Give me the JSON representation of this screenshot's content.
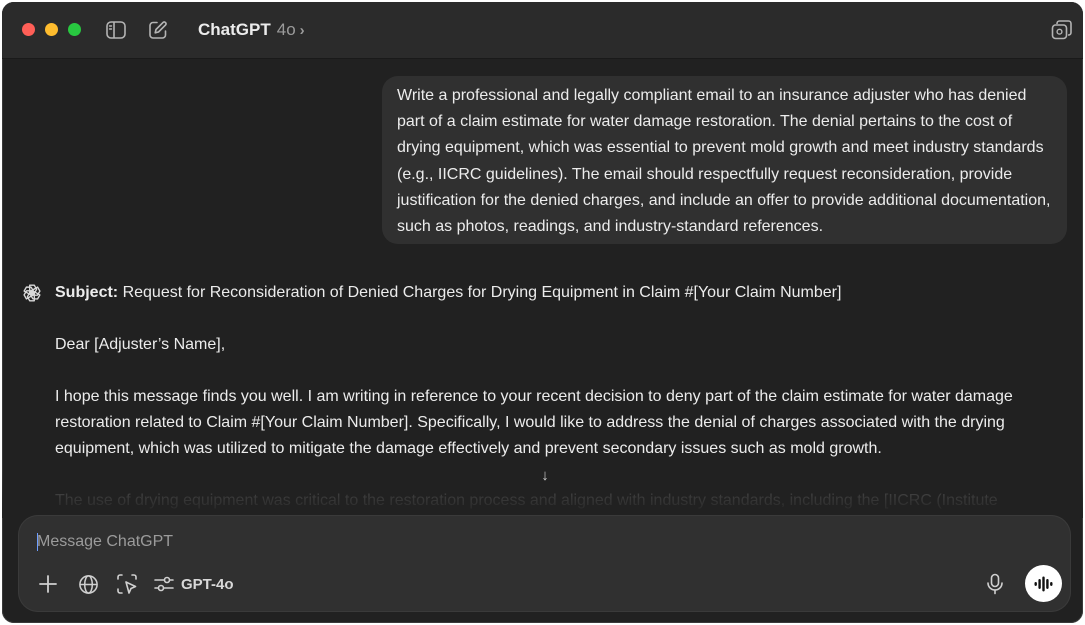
{
  "window": {
    "title": "ChatGPT",
    "model": "4o",
    "title_chevron": "›"
  },
  "user_message": {
    "text": "Write a professional and legally compliant email to an insurance adjuster who has denied part of a claim estimate for water damage restoration. The denial pertains to the cost of drying equipment, which was essential to prevent mold growth and meet industry standards (e.g., IICRC guidelines). The email should respectfully request reconsideration, provide justification for the denied charges, and include an offer to provide additional documentation, such as photos, readings, and industry-standard references."
  },
  "assistant_message": {
    "subject_label": "Subject:",
    "subject_text": " Request for Reconsideration of Denied Charges for Drying Equipment in Claim #[Your Claim Number]",
    "greeting": "Dear [Adjuster’s Name],",
    "paragraph_1": "I hope this message finds you well. I am writing in reference to your recent decision to deny part of the claim estimate for water damage restoration related to Claim #[Your Claim Number]. Specifically, I would like to address the denial of charges associated with the drying equipment, which was utilized to mitigate the damage effectively and prevent secondary issues such as mold growth.",
    "paragraph_2_partial": "The use of drying equipment was critical to the restoration process and aligned with industry standards, including the [IICRC (Institute"
  },
  "scroll_down_glyph": "↓",
  "composer": {
    "placeholder": "Message ChatGPT",
    "model_label": "GPT-4o"
  },
  "icons": {
    "titlebar": [
      "sidebar-toggle-icon",
      "new-chat-icon",
      "temporary-chat-icon"
    ],
    "assistant": "openai-logo-icon",
    "composer": [
      "plus-icon",
      "globe-icon",
      "screen-select-icon",
      "sliders-icon",
      "microphone-icon",
      "voice-waveform-icon"
    ]
  },
  "colors": {
    "window_bg": "#212121",
    "titlebar_bg": "#2b2b2b",
    "bubble_bg": "#303030",
    "text": "#ececec",
    "muted": "#9b9b9b",
    "traffic_red": "#ff5f57",
    "traffic_yellow": "#febc2e",
    "traffic_green": "#28c840"
  }
}
